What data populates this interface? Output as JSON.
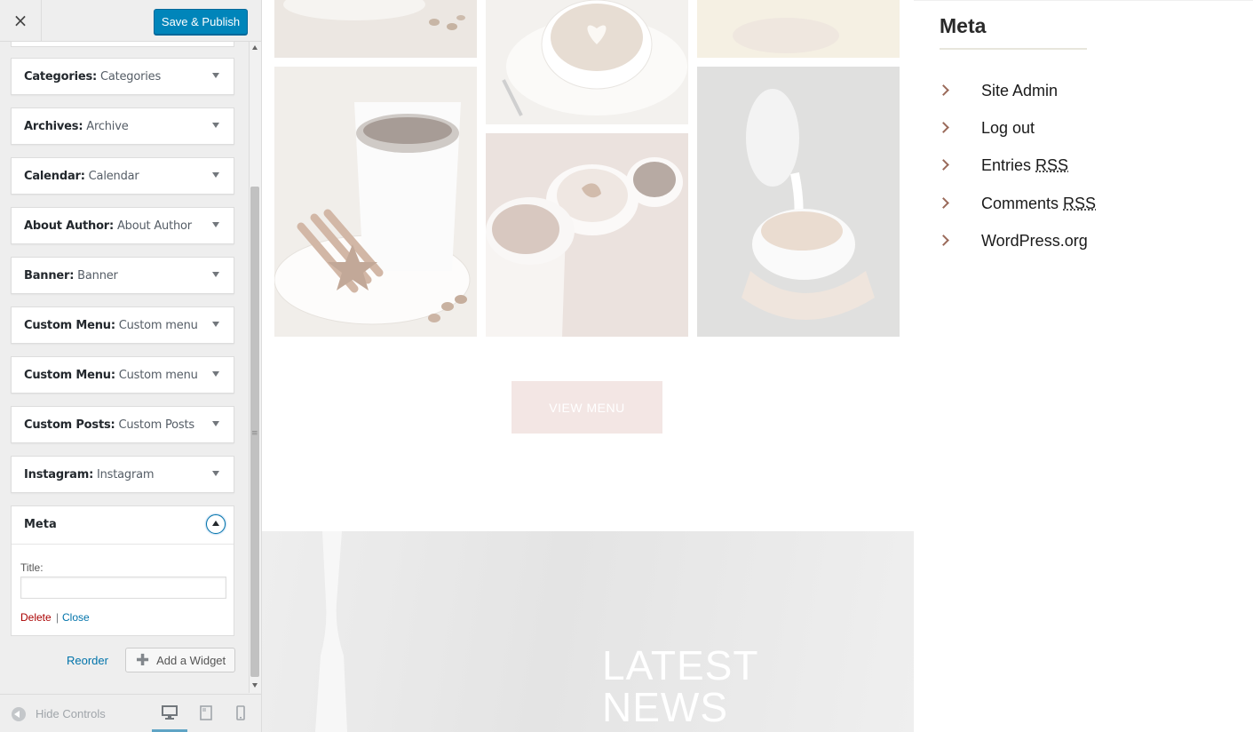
{
  "customizer": {
    "close_label": "×",
    "save_label": "Save & Publish",
    "widgets": [
      {
        "type": "Categories",
        "title": "Categories"
      },
      {
        "type": "Archives",
        "title": "Archive"
      },
      {
        "type": "Calendar",
        "title": "Calendar"
      },
      {
        "type": "About Author",
        "title": "About Author"
      },
      {
        "type": "Banner",
        "title": "Banner"
      },
      {
        "type": "Custom Menu",
        "title": "Custom menu"
      },
      {
        "type": "Custom Menu",
        "title": "Custom menu"
      },
      {
        "type": "Custom Posts",
        "title": "Custom Posts"
      },
      {
        "type": "Instagram",
        "title": "Instagram"
      }
    ],
    "open_widget": {
      "title": "Meta",
      "title_field_label": "Title:",
      "title_field_value": "",
      "delete_label": "Delete",
      "separator": "|",
      "close_label": "Close"
    },
    "reorder_label": "Reorder",
    "add_widget_label": "Add a Widget",
    "footer": {
      "hide_controls_label": "Hide Controls",
      "devices": [
        "desktop-icon",
        "tablet-icon",
        "mobile-icon"
      ],
      "active_device": "desktop"
    }
  },
  "preview": {
    "view_menu_label": "VIEW MENU",
    "news_title_line1": "LATEST",
    "news_title_line2": "NEWS",
    "sidebar": {
      "title": "Meta",
      "items": [
        {
          "label": "Site Admin",
          "abbr": ""
        },
        {
          "label": "Log out",
          "abbr": ""
        },
        {
          "label": "Entries ",
          "abbr": "RSS"
        },
        {
          "label": "Comments ",
          "abbr": "RSS"
        },
        {
          "label": "WordPress.org",
          "abbr": ""
        }
      ]
    }
  },
  "colors": {
    "primary_button": "#0085ba",
    "link": "#0073aa",
    "delete_link": "#aa0000",
    "view_menu_button": "#f3e6e4"
  }
}
